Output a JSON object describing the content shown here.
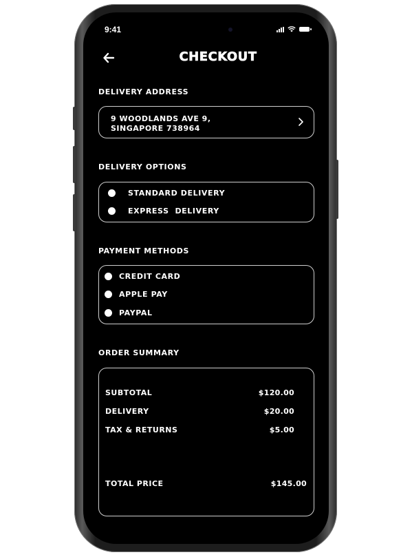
{
  "status_bar": {
    "time": "9:41"
  },
  "header": {
    "title": "CHECKOUT",
    "back_icon": "arrow-left-icon"
  },
  "delivery_address": {
    "label": "DELIVERY ADDRESS",
    "line1": "9 WOODLANDS AVE 9,",
    "line2": "SINGAPORE 738964",
    "chevron_icon": "chevron-right-icon"
  },
  "delivery_options": {
    "label": "DELIVERY OPTIONS",
    "options": [
      {
        "label": "STANDARD DELIVERY"
      },
      {
        "label": "EXPRESS  DELIVERY"
      }
    ]
  },
  "payment_methods": {
    "label": "PAYMENT METHODS",
    "options": [
      {
        "label": "CREDIT CARD"
      },
      {
        "label": "APPLE PAY"
      },
      {
        "label": "PAYPAL"
      }
    ]
  },
  "order_summary": {
    "label": "ORDER SUMMARY",
    "rows": [
      {
        "label": "SUBTOTAL",
        "value": "$120.00"
      },
      {
        "label": "DELIVERY",
        "value": "$20.00"
      },
      {
        "label": "TAX & RETURNS",
        "value": "$5.00"
      }
    ],
    "total_label": "TOTAL PRICE",
    "total_value": "$145.00"
  },
  "colors": {
    "background": "#000000",
    "text": "#ffffff",
    "border": "#cfcfcf"
  }
}
